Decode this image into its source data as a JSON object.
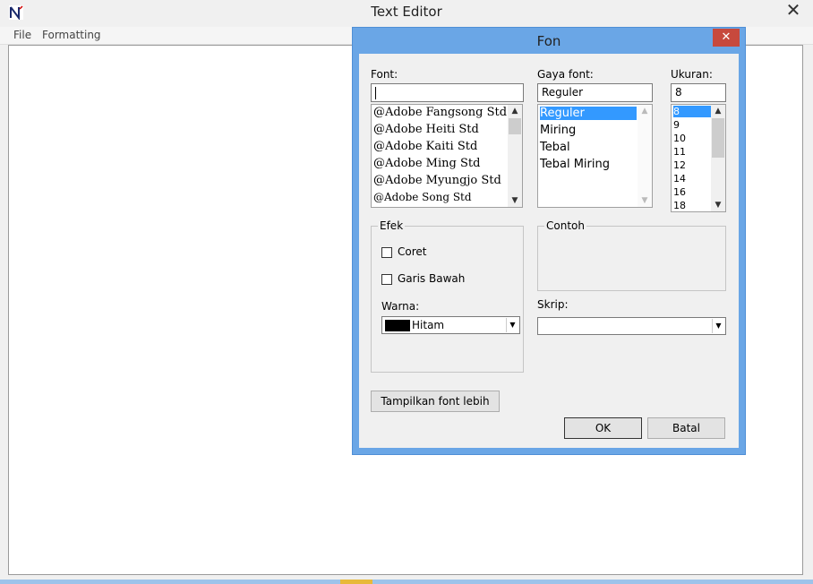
{
  "app": {
    "title": "Text Editor",
    "close_glyph": "✕",
    "menu": [
      "File",
      "Formatting"
    ]
  },
  "dialog": {
    "title": "Fon",
    "close_glyph": "✕",
    "font": {
      "label": "Font:",
      "value": "",
      "items": [
        "@Adobe Fangsong Std",
        "@Adobe Heiti Std",
        "@Adobe Kaiti Std",
        "@Adobe Ming Std",
        "@Adobe Myungjo Std",
        "@Adobe Song Std"
      ]
    },
    "style": {
      "label": "Gaya font:",
      "value": "Reguler",
      "items": [
        "Reguler",
        "Miring",
        "Tebal",
        "Tebal Miring"
      ],
      "selected_index": 0
    },
    "size": {
      "label": "Ukuran:",
      "value": "8",
      "items": [
        "8",
        "9",
        "10",
        "11",
        "12",
        "14",
        "16",
        "18"
      ],
      "selected_index": 0
    },
    "effects": {
      "label": "Efek",
      "strikeout_label": "Coret",
      "strikeout_checked": false,
      "underline_label": "Garis Bawah",
      "underline_checked": false,
      "color_label": "Warna:",
      "color_value": "Hitam",
      "color_swatch": "#000000"
    },
    "sample": {
      "label": "Contoh"
    },
    "script": {
      "label": "Skrip:",
      "value": ""
    },
    "show_more_label": "Tampilkan font lebih",
    "ok_label": "OK",
    "cancel_label": "Batal"
  },
  "colors": {
    "dialog_frame": "#6aa6e6",
    "close_button": "#c7493d",
    "selection": "#3399ff"
  }
}
